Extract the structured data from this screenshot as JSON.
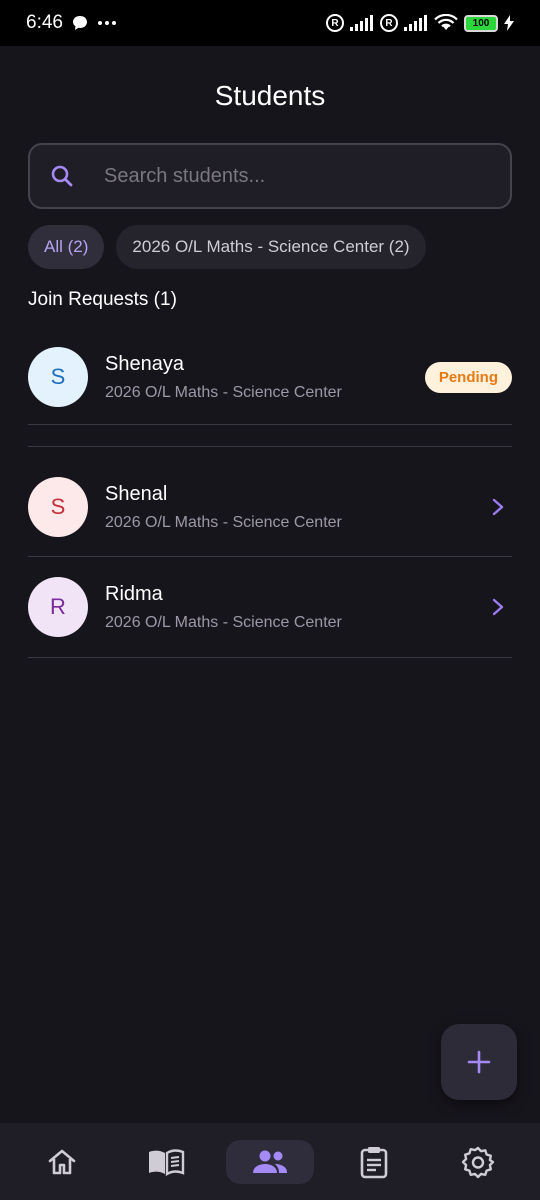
{
  "status_bar": {
    "time": "6:46",
    "battery": "100"
  },
  "header": {
    "title": "Students"
  },
  "search": {
    "placeholder": "Search students..."
  },
  "filters": [
    {
      "label": "All (2)",
      "active": true
    },
    {
      "label": "2026 O/L Maths - Science Center (2)",
      "active": false
    }
  ],
  "join_requests": {
    "title": "Join Requests (1)",
    "items": [
      {
        "initial": "S",
        "name": "Shenaya",
        "class": "2026 O/L Maths - Science Center",
        "status": "Pending"
      }
    ]
  },
  "students": [
    {
      "initial": "S",
      "name": "Shenal",
      "class": "2026 O/L Maths - Science Center"
    },
    {
      "initial": "R",
      "name": "Ridma",
      "class": "2026 O/L Maths - Science Center"
    }
  ],
  "colors": {
    "accent": "#9a7cf0",
    "background": "#17151c",
    "pending_bg": "#fff1dc",
    "pending_text": "#e67a14",
    "avatar_blue_bg": "#e3f2fd",
    "avatar_blue_text": "#1e6fc0",
    "avatar_red_bg": "#fde8ea",
    "avatar_red_text": "#c62f3c",
    "avatar_purple_bg": "#f1e4f6",
    "avatar_purple_text": "#7b2a9c"
  },
  "nav": [
    {
      "icon": "home-icon",
      "active": false
    },
    {
      "icon": "book-icon",
      "active": false
    },
    {
      "icon": "people-icon",
      "active": true
    },
    {
      "icon": "clipboard-icon",
      "active": false
    },
    {
      "icon": "settings-icon",
      "active": false
    }
  ]
}
